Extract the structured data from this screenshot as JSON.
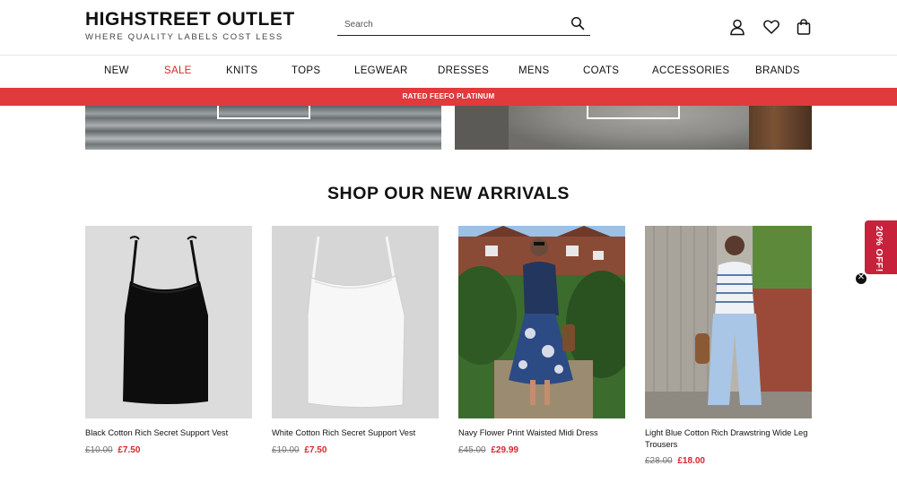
{
  "header": {
    "logo_title": "HIGHSTREET OUTLET",
    "logo_tagline": "WHERE QUALITY LABELS COST LESS",
    "search_placeholder": "Search"
  },
  "nav": {
    "items": [
      "NEW",
      "SALE",
      "KNITS",
      "TOPS",
      "LEGWEAR",
      "DRESSES",
      "MENS",
      "COATS",
      "ACCESSORIES",
      "BRANDS"
    ]
  },
  "banner": {
    "text": "RATED FEEFO PLATINUM"
  },
  "section": {
    "title": "SHOP OUR NEW ARRIVALS"
  },
  "products": [
    {
      "name": "Black Cotton Rich Secret Support Vest",
      "old_price": "£10.00",
      "price": "£7.50"
    },
    {
      "name": "White Cotton Rich Secret Support Vest",
      "old_price": "£10.00",
      "price": "£7.50"
    },
    {
      "name": "Navy Flower Print Waisted Midi Dress",
      "old_price": "£45.00",
      "price": "£29.99"
    },
    {
      "name": "Light Blue Cotton Rich Drawstring Wide Leg Trousers",
      "old_price": "£28.00",
      "price": "£18.00"
    }
  ],
  "promo": {
    "tab_label": "20% OFF!",
    "close_symbol": "✕"
  },
  "colors": {
    "sale_red": "#d9252b",
    "banner_red": "#e03a3c",
    "promo_tab": "#c8213b"
  },
  "icons": [
    "search-icon",
    "account-icon",
    "wishlist-heart-icon",
    "shopping-bag-icon",
    "close-icon"
  ]
}
